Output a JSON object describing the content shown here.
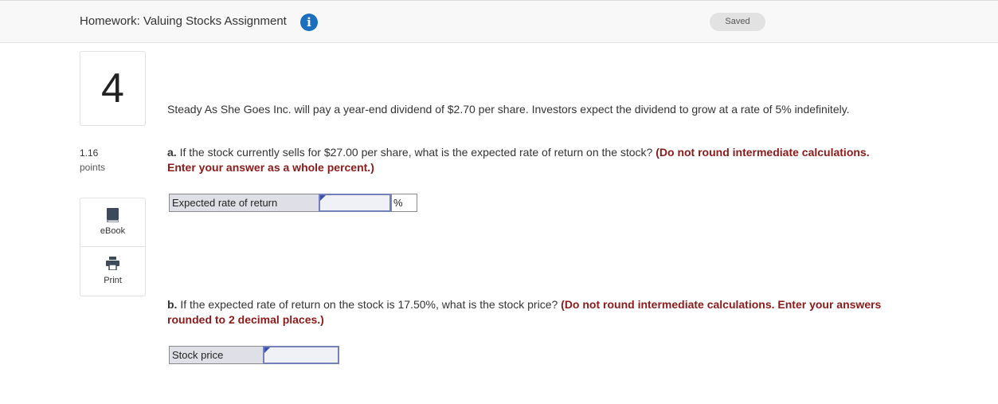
{
  "header": {
    "title": "Homework: Valuing Stocks Assignment",
    "info_icon": "info-circle-icon",
    "saved": "Saved"
  },
  "question": {
    "number": "4",
    "points_value": "1.16",
    "points_label": "points"
  },
  "tools": {
    "ebook": {
      "label": "eBook",
      "icon": "book-icon"
    },
    "print": {
      "label": "Print",
      "icon": "printer-icon"
    }
  },
  "content": {
    "intro": "Steady As She Goes Inc. will pay a year-end dividend of $2.70 per share. Investors expect the dividend to grow at a rate of 5% indefinitely.",
    "part_a": {
      "prefix": "a.",
      "text": " If the stock currently sells for $27.00 per share, what is the expected rate of return on the stock? ",
      "instruction": "(Do not round intermediate calculations. Enter your answer as a whole percent.)"
    },
    "part_b": {
      "prefix": "b.",
      "text": " If the expected rate of return on the stock is 17.50%, what is the stock price? ",
      "instruction": "(Do not round intermediate calculations. Enter your answers rounded to 2 decimal places.)"
    }
  },
  "answers": {
    "a": {
      "label": "Expected rate of return",
      "value": "",
      "unit": "%"
    },
    "b": {
      "label": "Stock price",
      "value": ""
    }
  },
  "colors": {
    "instruction_red": "#8b1a1a",
    "info_blue": "#1c6fbf",
    "input_border": "#7480b7",
    "label_bg": "#dfe0e7"
  }
}
